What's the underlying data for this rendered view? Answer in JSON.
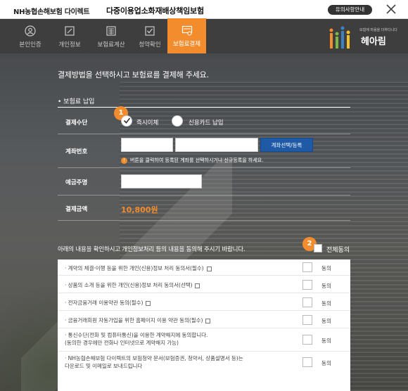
{
  "titlebar": {
    "brand": "NH농협손해보험 다이렉트",
    "title": "다중이용업소화재배상책임보험",
    "notice_label": "유의사항안내"
  },
  "steps": [
    {
      "label": "본인인증",
      "icon": "person-icon"
    },
    {
      "label": "개인정보",
      "icon": "edit-icon"
    },
    {
      "label": "보험료계산",
      "icon": "calculator-icon"
    },
    {
      "label": "청약확인",
      "icon": "checkbox-icon"
    },
    {
      "label": "보험료결제",
      "icon": "payment-icon",
      "active": true
    }
  ],
  "logo": {
    "slogan": "보험에 마음을 더하다니다",
    "word": "헤아림"
  },
  "headline": "결제방법을 선택하시고 보험료를 결제해 주세요.",
  "section_title": "• 보험료 납입",
  "payment": {
    "method_label": "결제수단",
    "badge1": "1",
    "option_transfer": "즉시이체",
    "option_card": "신용카드 납입",
    "account_label": "계좌번호",
    "account_button": "계좌선택/등록",
    "hint": "버튼을 클릭하여 등록된 계좌를 선택하시거나 신규등록을 하세요.",
    "holder_label": "예금주명",
    "amount_label": "결제금액",
    "amount_value": "10,800원"
  },
  "agreement": {
    "intro": "아래의 내용을 확인하시고 개인정보처리 등의 내용을 동의해 주시기 바랍니다.",
    "badge2": "2",
    "all_label": "전체동의",
    "agree_label": "동의",
    "items": [
      {
        "text": "· 계약의 체결·이행 등을 위한 개인(신용)정보 처리 동의서(필수)",
        "link": true
      },
      {
        "text": "· 상품의 소개 등을 위한 개인(신용)정보 처리 동의서(선택)",
        "link": true
      },
      {
        "text": "· 전자금융거래 이용약관 동의(필수)",
        "link": true
      },
      {
        "text": "· 금융거래회원 자동가입을 위한 홈페이지 이용 약관 동의(필수)",
        "link": true
      },
      {
        "text": "· 통신수단(전화 및 컴퓨터통신)을 이용한 계약해지에 동의합니다.",
        "text2": "(동의한 경우에만 전화나 인터넷으로 계약해지 가능)",
        "link": false
      },
      {
        "text": "· NH농협손해보험 다이렉트의 보험청약 문서(보험증권, 청약서, 상품설명서 등)는",
        "text2": "다운로드 및 이메일로 보내드립니다",
        "link": false
      }
    ]
  },
  "colors": {
    "accent": "#f28c2c",
    "nav": "#3e3e3e",
    "button": "#1f5aa6"
  }
}
